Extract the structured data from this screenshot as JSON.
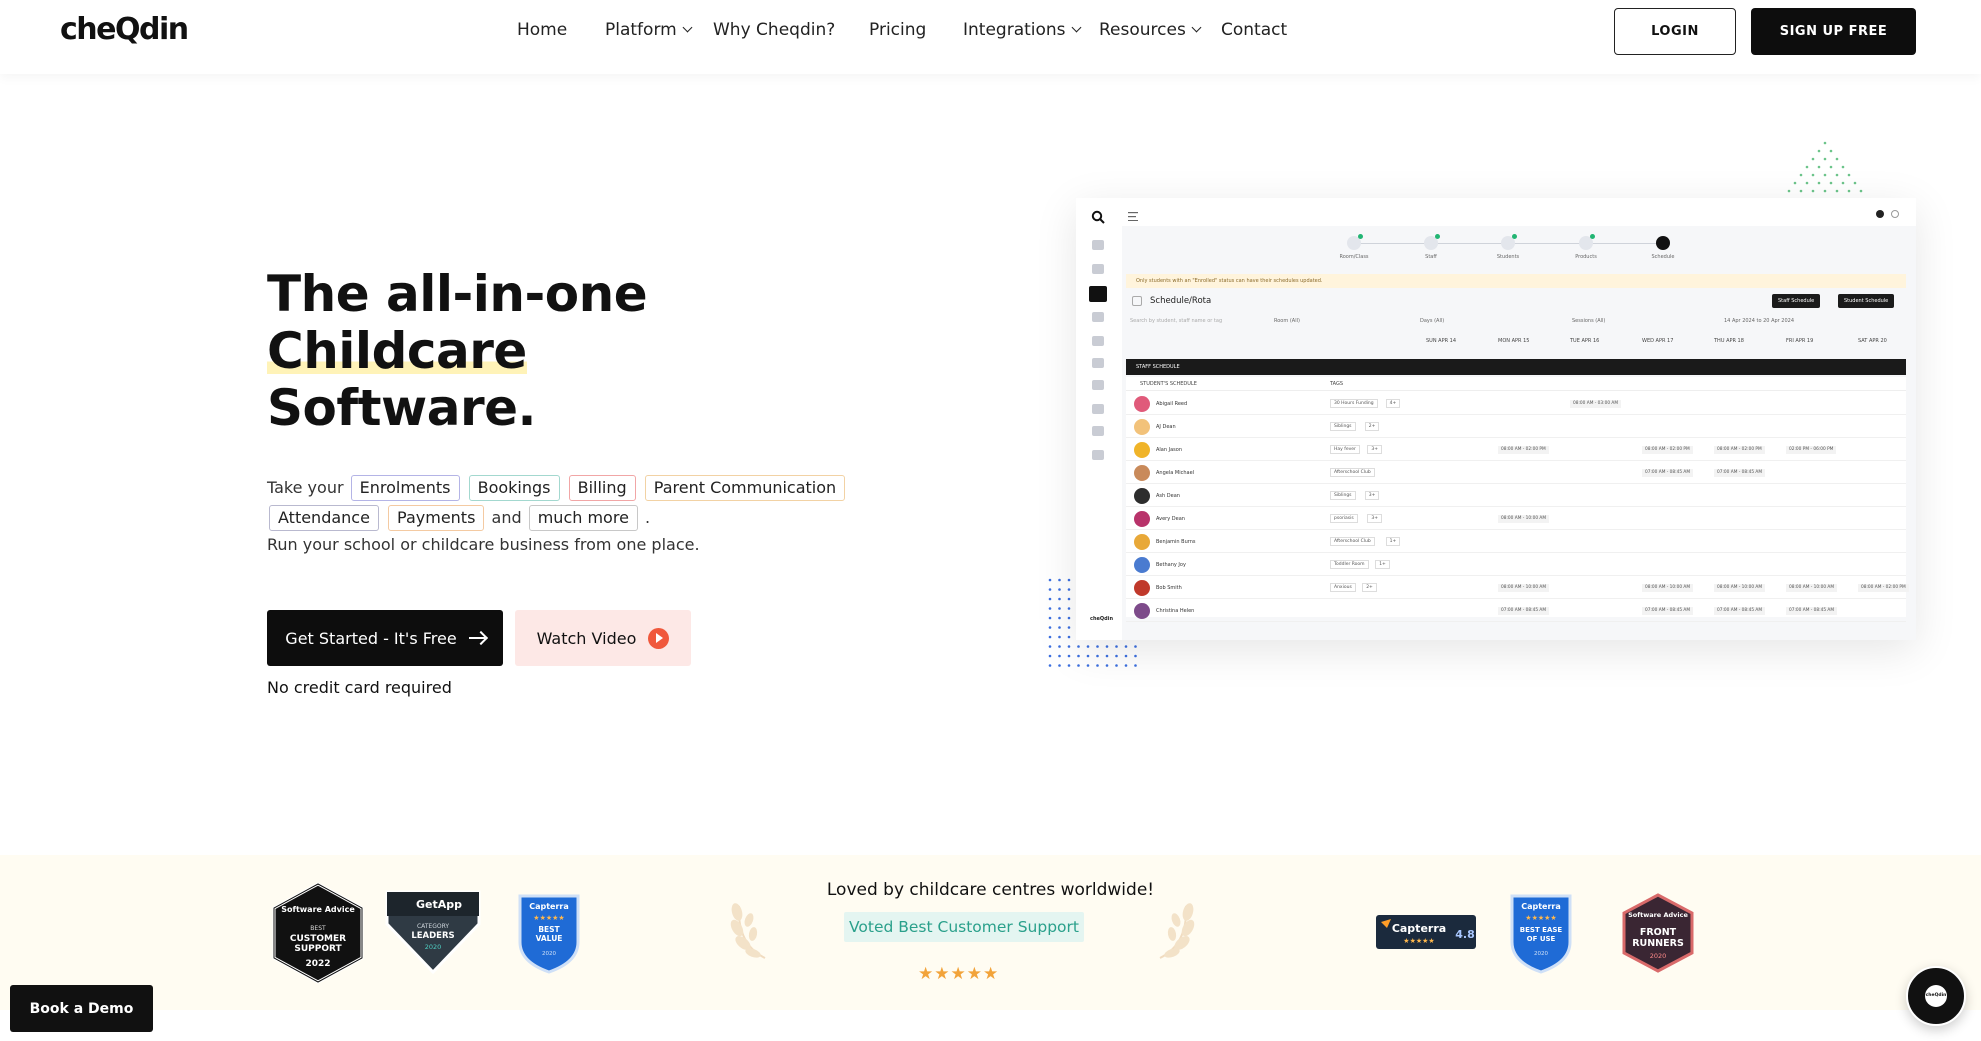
{
  "brand": {
    "logo_text": "cheQdin"
  },
  "nav": {
    "links": [
      {
        "label": "Home",
        "dropdown": false
      },
      {
        "label": "Platform",
        "dropdown": true
      },
      {
        "label": "Why Cheqdin?",
        "dropdown": false
      },
      {
        "label": "Pricing",
        "dropdown": false
      },
      {
        "label": "Integrations",
        "dropdown": true
      },
      {
        "label": "Resources",
        "dropdown": true
      },
      {
        "label": "Contact",
        "dropdown": false
      }
    ],
    "login_label": "LOGIN",
    "signup_label": "SIGN UP FREE"
  },
  "hero": {
    "title_line1": "The all-in-one",
    "title_line2": "Childcare",
    "title_line3": "Software.",
    "take_prefix": "Take your",
    "chips": [
      "Enrolments",
      "Bookings",
      "Billing",
      "Parent Communication",
      "Attendance",
      "Payments",
      "much more"
    ],
    "and_word": "and",
    "period": ".",
    "run_line": "Run your school or childcare business from one place.",
    "cta_primary": "Get Started - It's Free",
    "cta_secondary": "Watch Video",
    "no_card": "No credit card required"
  },
  "preview": {
    "steps": [
      "Room/Class",
      "Staff",
      "Students",
      "Products",
      "Schedule"
    ],
    "note": "Only students with an \"Enrolled\" status can have their schedules updated.",
    "title": "Schedule/Rota",
    "btn_staff": "Staff Schedule",
    "btn_student": "Student Schedule",
    "search_placeholder": "Search by student, staff name or tag",
    "filter_room": "Room (All)",
    "filter_days": "Days (All)",
    "filter_sessions": "Sessions (All)",
    "date_range": "14 Apr 2024 to 20 Apr 2024",
    "days": [
      "SUN APR 14",
      "MON APR 15",
      "TUE APR 16",
      "WED APR 17",
      "THU APR 18",
      "FRI APR 19",
      "SAT APR 20"
    ],
    "band": "STAFF SCHEDULE",
    "col_student": "STUDENT'S SCHEDULE",
    "col_tags": "TAGS",
    "rows": [
      {
        "name": "Abigail Reed",
        "tag": "30 Hours Funding",
        "more": "4+",
        "avatar": "#e05a7a",
        "slots": [
          {
            "col": 2,
            "t": "08:00 AM - 03:00 AM"
          }
        ]
      },
      {
        "name": "AJ Dean",
        "tag": "Siblings",
        "more": "2+",
        "avatar": "#f2c27a",
        "slots": []
      },
      {
        "name": "Alan Jason",
        "tag": "Hay fever",
        "more": "3+",
        "avatar": "#f0b429",
        "slots": [
          {
            "col": 1,
            "t": "08:00 AM - 02:00 PM"
          },
          {
            "col": 3,
            "t": "08:00 AM - 02:00 PM"
          },
          {
            "col": 4,
            "t": "08:00 AM - 02:00 PM"
          },
          {
            "col": 5,
            "t": "02:00 PM - 06:00 PM"
          }
        ]
      },
      {
        "name": "Angela Michael",
        "tag": "Afterschool Club",
        "more": "",
        "avatar": "#c98a5a",
        "slots": [
          {
            "col": 3,
            "t": "07:00 AM - 08:45 AM"
          },
          {
            "col": 4,
            "t": "07:00 AM - 08:45 AM"
          }
        ]
      },
      {
        "name": "Ash Dean",
        "tag": "Siblings",
        "more": "3+",
        "avatar": "#2d2d2d",
        "slots": []
      },
      {
        "name": "Avery Dean",
        "tag": "psoriasis",
        "more": "3+",
        "avatar": "#b8336a",
        "slots": [
          {
            "col": 1,
            "t": "08:00 AM - 10:00 AM"
          }
        ]
      },
      {
        "name": "Benjamin Burns",
        "tag": "Afterschool Club",
        "more": "1+",
        "avatar": "#e8a838",
        "slots": []
      },
      {
        "name": "Bethany Joy",
        "tag": "Toddler Room",
        "more": "1+",
        "avatar": "#4a7bd0",
        "slots": []
      },
      {
        "name": "Bob Smith",
        "tag": "Anxious",
        "more": "2+",
        "avatar": "#c0392b",
        "slots": [
          {
            "col": 1,
            "t": "08:00 AM - 10:00 AM"
          },
          {
            "col": 3,
            "t": "08:00 AM - 10:00 AM"
          },
          {
            "col": 4,
            "t": "08:00 AM - 10:00 AM"
          },
          {
            "col": 5,
            "t": "08:00 AM - 10:00 AM"
          },
          {
            "col": 6,
            "t": "08:00 AM - 02:00 PM"
          }
        ]
      },
      {
        "name": "Christina Helen",
        "tag": "",
        "more": "",
        "avatar": "#7d4b8a",
        "slots": [
          {
            "col": 1,
            "t": "07:00 AM - 08:45 AM"
          },
          {
            "col": 3,
            "t": "07:00 AM - 08:45 AM"
          },
          {
            "col": 4,
            "t": "07:00 AM - 08:45 AM"
          },
          {
            "col": 5,
            "t": "07:00 AM - 08:45 AM"
          }
        ]
      }
    ],
    "sidebar_logo": "cheQdin"
  },
  "awards": {
    "loved": "Loved by childcare centres worldwide!",
    "voted": "Voted Best Customer Support",
    "stars": "★★★★★",
    "left_badges": [
      {
        "brand": "Software Advice",
        "line1": "BEST",
        "line2": "CUSTOMER",
        "line3": "SUPPORT",
        "year": "2022"
      },
      {
        "brand": "GetApp",
        "line1": "CATEGORY",
        "line2": "LEADERS",
        "year": "2020"
      },
      {
        "brand": "Capterra",
        "line1": "BEST",
        "line2": "VALUE",
        "year": "2020"
      }
    ],
    "capterra_rating": {
      "brand": "Capterra",
      "score": "4.8"
    },
    "right_badges": [
      {
        "brand": "Capterra",
        "line1": "BEST EASE",
        "line2": "OF USE",
        "year": "2020"
      },
      {
        "brand": "Software Advice",
        "line1": "FRONT",
        "line2": "RUNNERS",
        "year": "2020"
      }
    ]
  },
  "floating": {
    "book_demo": "Book a Demo",
    "chat_logo": "cheQdin"
  },
  "colors": {
    "primary": "#0d0d0d",
    "accent_teal": "#2aa08b",
    "video_bg": "#fde8e6",
    "play_orange": "#f0583c",
    "strip_bg": "#fffcf2",
    "highlight": "#fff3b8",
    "star": "#f2a33a"
  },
  "icons": [
    "chevron-down-icon",
    "arrow-right-icon",
    "play-icon",
    "search-icon",
    "laurel-icon",
    "chat-icon"
  ]
}
